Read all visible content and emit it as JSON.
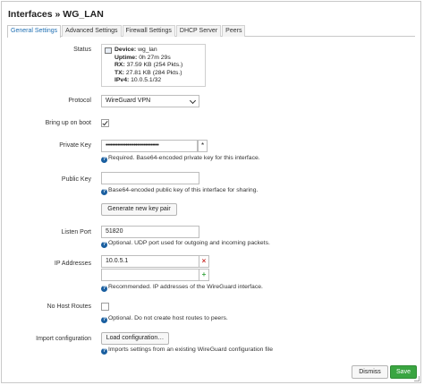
{
  "title": "Interfaces » WG_LAN",
  "tabs": [
    {
      "label": "General Settings",
      "active": true
    },
    {
      "label": "Advanced Settings",
      "active": false
    },
    {
      "label": "Firewall Settings",
      "active": false
    },
    {
      "label": "DHCP Server",
      "active": false
    },
    {
      "label": "Peers",
      "active": false
    }
  ],
  "status": {
    "label": "Status",
    "device_key": "Device:",
    "device_val": "wg_lan",
    "uptime_key": "Uptime:",
    "uptime_val": "0h 27m 29s",
    "rx_key": "RX:",
    "rx_val": "37.59 KB (254 Pkts.)",
    "tx_key": "TX:",
    "tx_val": "27.81 KB (284 Pkts.)",
    "ipv4_key": "IPv4:",
    "ipv4_val": "10.0.5.1/32"
  },
  "protocol": {
    "label": "Protocol",
    "value": "WireGuard VPN"
  },
  "bring_up": {
    "label": "Bring up on boot",
    "checked": true
  },
  "private_key": {
    "label": "Private Key",
    "value": "••••••••••••••••••••••••••••••••",
    "toggle": "*",
    "hint": "Required. Base64-encoded private key for this interface."
  },
  "public_key": {
    "label": "Public Key",
    "value": "",
    "hint": "Base64-encoded public key of this interface for sharing.",
    "generate_button": "Generate new key pair"
  },
  "listen_port": {
    "label": "Listen Port",
    "value": "51820",
    "hint": "Optional. UDP port used for outgoing and incoming packets."
  },
  "ip_addresses": {
    "label": "IP Addresses",
    "values": [
      "10.0.5.1",
      ""
    ],
    "remove": "×",
    "add": "+",
    "hint": "Recommended. IP addresses of the WireGuard interface."
  },
  "no_host_routes": {
    "label": "No Host Routes",
    "checked": false,
    "hint": "Optional. Do not create host routes to peers."
  },
  "import_config": {
    "label": "Import configuration",
    "button": "Load configuration…",
    "hint": "Imports settings from an existing WireGuard configuration file"
  },
  "footer": {
    "dismiss": "Dismiss",
    "save": "Save"
  },
  "colors": {
    "accent": "#1f6fb3",
    "save": "#3aa541",
    "remove": "#c9302c",
    "add": "#3aa541"
  }
}
